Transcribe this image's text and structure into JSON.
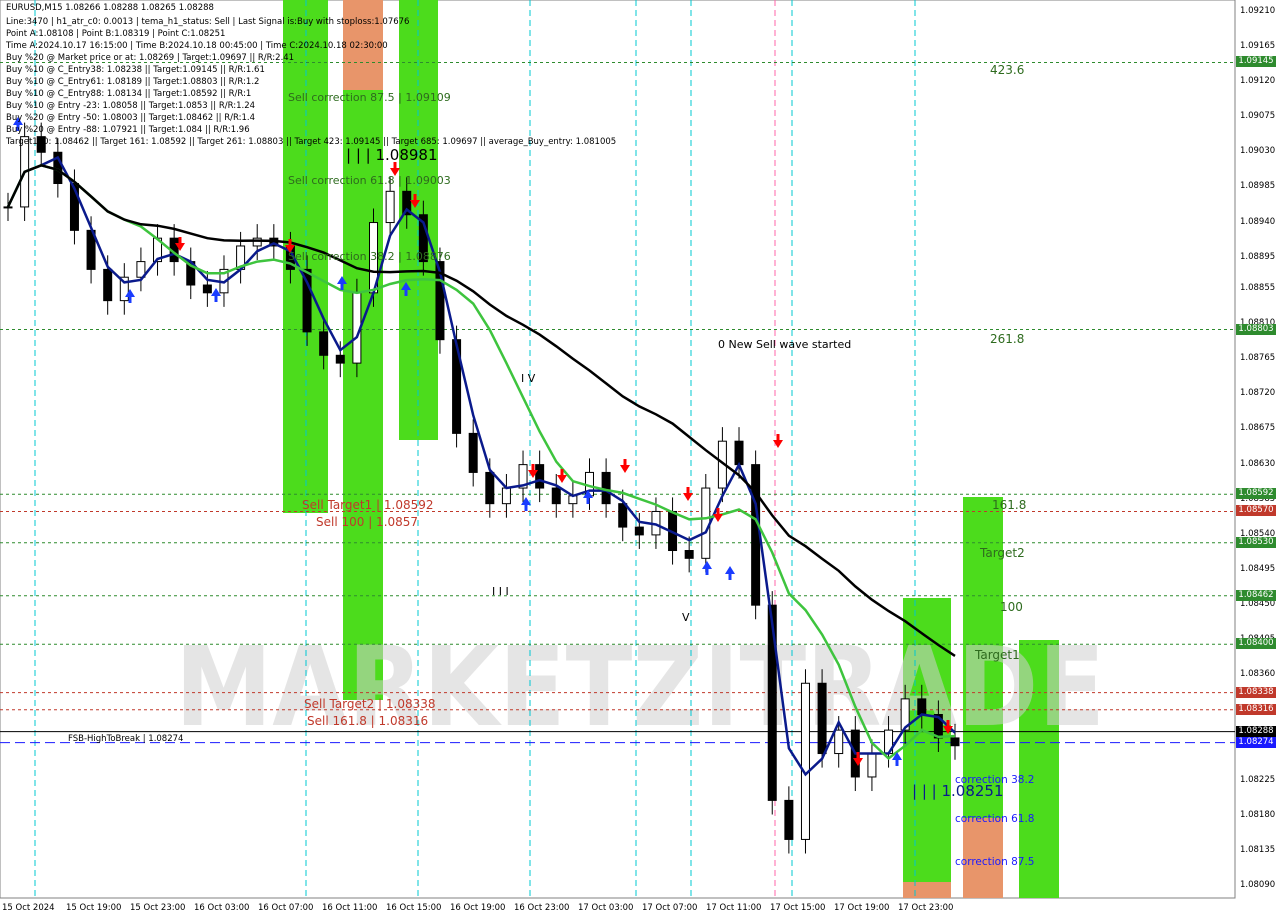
{
  "header": {
    "symbol_line": "EURUSD,M15   1.08266 1.08288 1.08265 1.08288",
    "lines": [
      "Line:3470  |  h1_atr_c0: 0.0013  |  tema_h1_status: Sell  |  Last Signal is:Buy with stoploss:1.07676",
      "Point A:1.08108  |  Point B:1.08319  |  Point C:1.08251",
      "Time A:2024.10.17 16:15:00  |  Time B:2024.10.18 00:45:00  |  Time C:2024.10.18 02:30:00",
      "Buy %20 @ Market price or at: 1.08269  |  Target:1.09697  ||  R/R:2.41",
      "Buy %10 @ C_Entry38: 1.08238  ||  Target:1.09145  ||  R/R:1.61",
      "Buy %10 @ C_Entry61: 1.08189  ||  Target:1.08803  ||  R/R:1.2",
      "Buy %10 @ C_Entry88: 1.08134  ||  Target:1.08592  ||  R/R:1",
      "Buy %10 @ Entry -23: 1.08058  ||  Target:1.0853  ||  R/R:1.24",
      "Buy %20 @ Entry -50: 1.08003  ||  Target:1.08462  ||  R/R:1.4",
      "Buy %20 @ Entry -88: 1.07921  ||  Target:1.084  ||  R/R:1.96",
      "Target100: 1.08462  ||  Target 161: 1.08592  ||  Target 261: 1.08803  ||  Target 423: 1.09145  ||  Target 685: 1.09697  ||  average_Buy_entry: 1.081005"
    ]
  },
  "watermark": "MARKETZITRADE",
  "colors": {
    "green_zone": "#4cdc1c",
    "orange_zone": "#e8956a",
    "black_ma": "#000000",
    "green_ma": "#3ec43e",
    "navy_ma": "#0a1a8c",
    "candle": "#000000",
    "level_green": "#2e8b2e",
    "level_red": "#c0392b",
    "fsb_blue": "#1a1aff",
    "sell_arrow": "#ff0000",
    "buy_arrow": "#1a3cff"
  },
  "chart_data": {
    "type": "candlestick",
    "symbol": "EURUSD",
    "timeframe": "M15",
    "last_ohlc": {
      "open": 1.08266,
      "high": 1.08288,
      "low": 1.08265,
      "close": 1.08288
    },
    "ylim": [
      1.08075,
      1.09225
    ],
    "y_ticks": [
      1.0921,
      1.09165,
      1.0912,
      1.09075,
      1.0903,
      1.08985,
      1.0894,
      1.08895,
      1.08855,
      1.0881,
      1.08765,
      1.0872,
      1.08675,
      1.0863,
      1.08585,
      1.0854,
      1.08495,
      1.0845,
      1.08405,
      1.0836,
      1.08315,
      1.0827,
      1.08225,
      1.0818,
      1.08135,
      1.0809
    ],
    "x_labels": [
      "15 Oct 2024",
      "15 Oct 19:00",
      "15 Oct 23:00",
      "16 Oct 03:00",
      "16 Oct 07:00",
      "16 Oct 11:00",
      "16 Oct 15:00",
      "16 Oct 19:00",
      "16 Oct 23:00",
      "17 Oct 03:00",
      "17 Oct 07:00",
      "17 Oct 11:00",
      "17 Oct 15:00",
      "17 Oct 19:00",
      "17 Oct 23:00"
    ],
    "price_levels": [
      {
        "value": 1.09145,
        "label": "423.6",
        "box": "1.09145",
        "color": "green"
      },
      {
        "value": 1.08803,
        "label": "261.8",
        "box": "1.08803",
        "color": "green"
      },
      {
        "value": 1.08592,
        "label": "161.8",
        "box": "1.08592",
        "color": "green"
      },
      {
        "value": 1.0857,
        "label": "",
        "box": "1.08570",
        "color": "red"
      },
      {
        "value": 1.0853,
        "label": "Target2",
        "box": "1.08530",
        "color": "green"
      },
      {
        "value": 1.08462,
        "label": "100",
        "box": "1.08462",
        "color": "green"
      },
      {
        "value": 1.084,
        "label": "Target1",
        "box": "1.08400",
        "color": "green"
      },
      {
        "value": 1.08338,
        "label": "",
        "box": "1.08338",
        "color": "red"
      },
      {
        "value": 1.08316,
        "label": "",
        "box": "1.08316",
        "color": "red"
      },
      {
        "value": 1.08288,
        "label": "",
        "box": "1.08288",
        "color": "black"
      },
      {
        "value": 1.08274,
        "label": "",
        "box": "1.08274",
        "color": "blue"
      }
    ],
    "sell_labels": [
      {
        "text": "Sell correction 87.5 | 1.09109",
        "value": 1.09109
      },
      {
        "text": "Sell correction 61.8 | 1.09003",
        "value": 1.09003
      },
      {
        "text": "Sell correction 38.2 | 1.08876",
        "value": 1.08876
      },
      {
        "text": "Sell Target1 | 1.08592",
        "value": 1.08592
      },
      {
        "text": "Sell 100 | 1.0857",
        "value": 1.0857
      },
      {
        "text": "Sell Target2 | 1.08338",
        "value": 1.08338
      },
      {
        "text": "Sell 161.8 | 1.08316",
        "value": 1.08316
      }
    ],
    "annotations": {
      "wave_text": "0 New Sell wave started",
      "point_high": "| | | 1.08981",
      "point_low": "| | | 1.08251",
      "fsb_label": "FSB-HighToBreak  |  1.08274",
      "roman_iv": "I V",
      "roman_iii": "I I I",
      "roman_v": "V",
      "correction_38": "correction 38.2",
      "correction_61": "correction 61.8",
      "correction_87": "correction 87.5"
    },
    "series": [
      {
        "name": "close",
        "values": [
          1.0896,
          1.0905,
          1.0903,
          1.0899,
          1.0893,
          1.0888,
          1.0884,
          1.0887,
          1.0889,
          1.0892,
          1.0889,
          1.0886,
          1.0885,
          1.0888,
          1.0891,
          1.0892,
          1.0891,
          1.0888,
          1.088,
          1.0877,
          1.0876,
          1.0885,
          1.0894,
          1.0898,
          1.0895,
          1.0889,
          1.0879,
          1.0867,
          1.0862,
          1.0858,
          1.086,
          1.0863,
          1.086,
          1.0858,
          1.0859,
          1.0862,
          1.0858,
          1.0855,
          1.0854,
          1.0857,
          1.0852,
          1.0851,
          1.086,
          1.0866,
          1.0863,
          1.0845,
          1.082,
          1.0815,
          1.0835,
          1.0826,
          1.0829,
          1.0823,
          1.0826,
          1.0829,
          1.0833,
          1.0831,
          1.0828,
          1.0827
        ]
      }
    ]
  }
}
